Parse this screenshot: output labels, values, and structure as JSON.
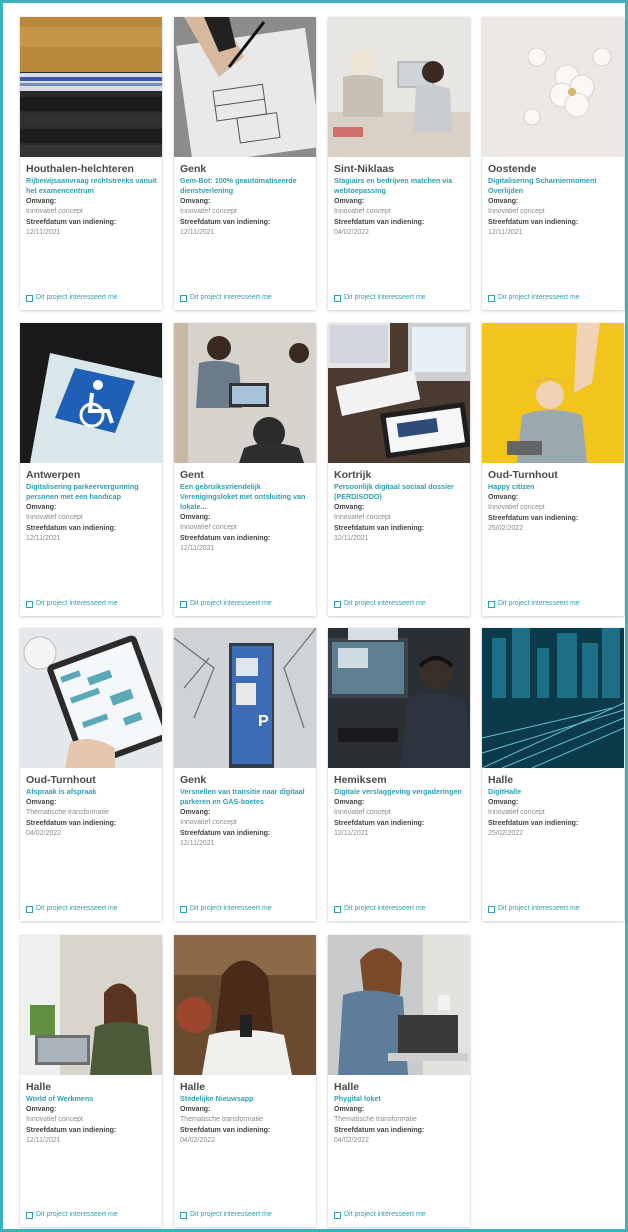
{
  "labels": {
    "omvang": "Omvang:",
    "deadline": "Streefdatum van indiening:",
    "interest": "Dit project interesseert me"
  },
  "colors": {
    "frame": "#3bb3bd",
    "accent": "#2f9fb0"
  },
  "projects": [
    {
      "city": "Houthalen-helchteren",
      "title": "Rijbewijsaanvraag rechtstreeks vanuit het examencentrum",
      "omvang": "Innovatief concept",
      "date": "12/11/2021",
      "image": "wallet-licence"
    },
    {
      "city": "Genk",
      "title": "Gem-Bot: 100% geautomatiseerde dienstverlening",
      "omvang": "Innovatief concept",
      "date": "12/11/2021",
      "image": "hand-drawing-plan"
    },
    {
      "city": "Sint-Niklaas",
      "title": "Stagiairs en bedrijven matchen via webtoepassing",
      "omvang": "Innovatief concept",
      "date": "04/02/2022",
      "image": "two-women-at-desk"
    },
    {
      "city": "Oostende",
      "title": "Digitalisering Scharniermoment Overlijden",
      "omvang": "Innovatief concept",
      "date": "12/11/2021",
      "image": "white-blossom"
    },
    {
      "city": "Antwerpen",
      "title": "Digitalisering parkeervergunning personen met een handicap",
      "omvang": "Innovatief concept",
      "date": "12/11/2021",
      "image": "disability-parking-card"
    },
    {
      "city": "Gent",
      "title": "Een gebruiksvriendelijk Verenigingsloket met ontsluiting van lokale...",
      "omvang": "Innovatief concept",
      "date": "12/11/2021",
      "image": "team-meeting-laptops"
    },
    {
      "city": "Kortrijk",
      "title": "Persoonlijk digitaal sociaal dossier (PERDISODO)",
      "omvang": "Innovatief concept",
      "date": "12/11/2021",
      "image": "desk-computer-tablet"
    },
    {
      "city": "Oud-Turnhout",
      "title": "Happy citizen",
      "omvang": "Innovatief concept",
      "date": "25/02/2022",
      "image": "happy-woman-yellow"
    },
    {
      "city": "Oud-Turnhout",
      "title": "Afspraak is afspraak",
      "omvang": "Thematische transformatie",
      "date": "04/02/2022",
      "image": "tablet-calendar"
    },
    {
      "city": "Genk",
      "title": "Versnellen van transitie naar digitaal parkeren en GAS-boetes",
      "omvang": "Innovatief concept",
      "date": "12/11/2021",
      "image": "parking-meter"
    },
    {
      "city": "Hemiksem",
      "title": "Digitale verslaggeving vergaderingen",
      "omvang": "Innovatief concept",
      "date": "12/11/2021",
      "image": "man-headphones-monitors"
    },
    {
      "city": "Halle",
      "title": "DigitHalle",
      "omvang": "Innovatief concept",
      "date": "25/02/2022",
      "image": "digital-city"
    },
    {
      "city": "Halle",
      "title": "World of Werkmens",
      "omvang": "Innovatief concept",
      "date": "12/11/2021",
      "image": "woman-laptop-office"
    },
    {
      "city": "Halle",
      "title": "Stedelijke Nieuwsapp",
      "omvang": "Thematische transformatie",
      "date": "04/02/2022",
      "image": "woman-phone-outdoor"
    },
    {
      "city": "Halle",
      "title": "Phygital loket",
      "omvang": "Thematische transformatie",
      "date": "04/02/2022",
      "image": "woman-typing-laptop"
    }
  ]
}
